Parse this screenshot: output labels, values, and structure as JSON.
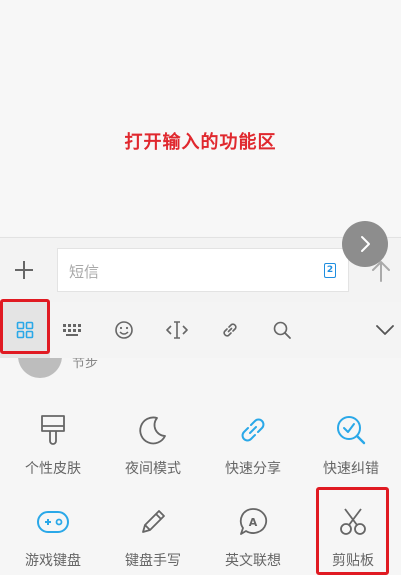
{
  "annotation": {
    "text": "打开输入的功能区"
  },
  "compose": {
    "sms_placeholder": "短信",
    "sim_badge": "2"
  },
  "partial_row": {
    "text": "节步"
  },
  "toolbar": {
    "items": [
      {
        "name": "function-grid-icon",
        "active": true
      },
      {
        "name": "keyboard-icon"
      },
      {
        "name": "emoji-icon"
      },
      {
        "name": "cursor-move-icon"
      },
      {
        "name": "link-icon"
      },
      {
        "name": "search-icon"
      },
      {
        "name": "collapse-chevron-icon"
      }
    ]
  },
  "functions": {
    "row1": [
      {
        "label": "个性皮肤",
        "icon": "paint-brush-icon"
      },
      {
        "label": "夜间模式",
        "icon": "moon-icon"
      },
      {
        "label": "快速分享",
        "icon": "share-link-icon"
      },
      {
        "label": "快速纠错",
        "icon": "search-check-icon"
      }
    ],
    "row2": [
      {
        "label": "游戏键盘",
        "icon": "gamepad-icon"
      },
      {
        "label": "键盘手写",
        "icon": "pen-icon"
      },
      {
        "label": "英文联想",
        "icon": "english-bubble-icon"
      },
      {
        "label": "剪贴板",
        "icon": "scissors-icon"
      }
    ]
  },
  "colors": {
    "accent_blue": "#2aa8e8",
    "highlight_red": "#e01a22",
    "icon_gray": "#666666"
  }
}
